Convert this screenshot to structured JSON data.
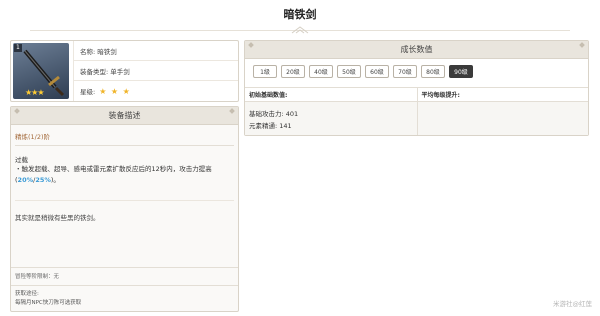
{
  "page": {
    "title": "暗铁剑"
  },
  "weapon": {
    "rarity_badge": "1",
    "name_label": "名称:",
    "name": "暗铁剑",
    "type_label": "装备类型:",
    "type": "单手剑",
    "star_label": "星级:",
    "stars": "★ ★ ★",
    "image_stars": "★★★"
  },
  "description": {
    "header": "装备描述",
    "refinement": "精炼(1/2)阶",
    "effect_name": "过载",
    "effect_text_pre": "・触发超载、超导、感电或雷元素扩散反应后的12秒内，攻击力提高(",
    "effect_val1": "20%",
    "effect_slash": "/",
    "effect_val2": "25%",
    "effect_text_post": ")。",
    "flavor": "其实就是稍微有些黑的铁剑。",
    "adventure_limit": "冒险等阶限制：无",
    "source_label": "获取途径:",
    "source": "每隔月NPC快刀陈可选获取"
  },
  "growth": {
    "header": "成长数值",
    "levels": [
      "1级",
      "20级",
      "40级",
      "50级",
      "60级",
      "70级",
      "80级",
      "90级"
    ],
    "active_level": "90级",
    "base_header": "初始基础数值:",
    "avg_header": "平均每级提升:",
    "base_atk": "基础攻击力: 401",
    "elem_mastery": "元素精通: 141"
  },
  "footer": {
    "watermark": "米游社@红莲"
  },
  "colors": {
    "accent_text": "#a46b3c",
    "highlight": "#3b9bd6",
    "star": "#f0b429",
    "active_button": "#3a3a3a"
  }
}
